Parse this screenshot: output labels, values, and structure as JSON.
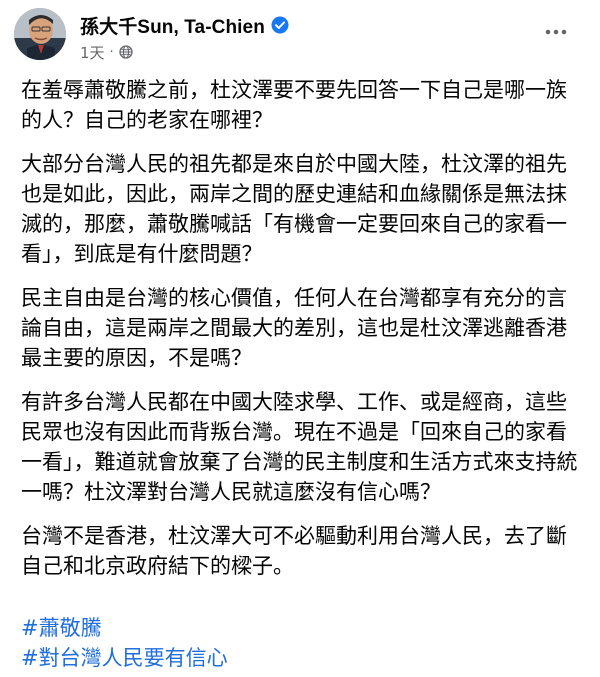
{
  "author": {
    "name": "孫大千Sun, Ta-Chien",
    "verified": true
  },
  "post_meta": {
    "timestamp": "1天",
    "separator": "·",
    "audience_icon": "globe-icon"
  },
  "more_button_icon": "more-options-icon",
  "paragraphs": [
    "在羞辱蕭敬騰之前，杜汶澤要不要先回答一下自己是哪一族的人？自己的老家在哪裡？",
    "大部分台灣人民的祖先都是來自於中國大陸，杜汶澤的祖先也是如此，因此，兩岸之間的歷史連結和血緣關係是無法抹滅的，那麼，蕭敬騰喊話「有機會一定要回來自己的家看一看」，到底是有什麼問題？",
    "民主自由是台灣的核心價值，任何人在台灣都享有充分的言論自由，這是兩岸之間最大的差別，這也是杜汶澤逃離香港最主要的原因，不是嗎？",
    "有許多台灣人民都在中國大陸求學、工作、或是經商，這些民眾也沒有因此而背叛台灣。現在不過是「回來自己的家看一看」，難道就會放棄了台灣的民主制度和生活方式來支持統一嗎？杜汶澤對台灣人民就這麼沒有信心嗎？",
    "台灣不是香港，杜汶澤大可不必驅動利用台灣人民，去了斷自己和北京政府結下的樑子。"
  ],
  "hashtags": [
    "#蕭敬騰",
    "#對台灣人民要有信心"
  ],
  "colors": {
    "hashtag": "#216fdb",
    "verified_badge": "#1877f2",
    "secondary_text": "#65676b"
  }
}
